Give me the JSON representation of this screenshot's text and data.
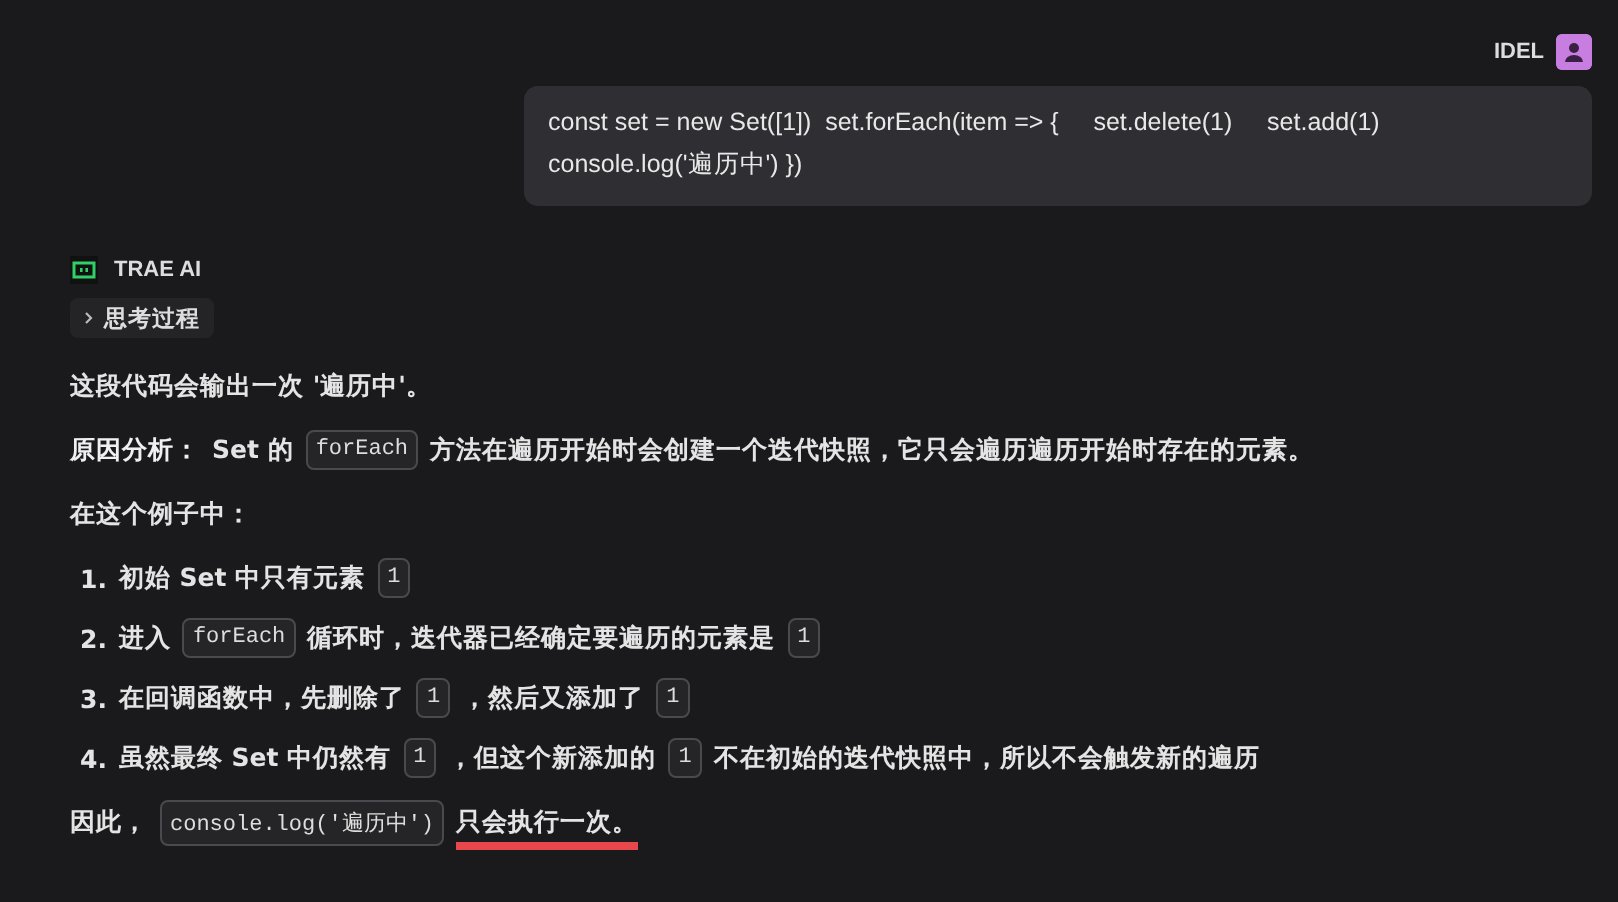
{
  "user": {
    "name": "IDEL",
    "message": "const set = new Set([1])  set.forEach(item => {     set.delete(1)     set.add(1)     console.log('遍历中') })"
  },
  "assistant": {
    "name": "TRAE AI",
    "thinking": {
      "label": "思考过程",
      "expanded": false
    },
    "blocks": [
      {
        "kind": "paragraph",
        "parts": [
          {
            "kind": "text",
            "text": "这段代码会输出一次 '遍历中'。"
          }
        ]
      },
      {
        "kind": "paragraph",
        "parts": [
          {
            "kind": "strong",
            "text": "原因分析："
          },
          {
            "kind": "text",
            "text": "Set 的"
          },
          {
            "kind": "code",
            "text": "forEach"
          },
          {
            "kind": "text",
            "text": "方法在遍历开始时会创建一个迭代快照，它只会遍历遍历开始时存在的元素。"
          }
        ]
      },
      {
        "kind": "paragraph",
        "parts": [
          {
            "kind": "text",
            "text": "在这个例子中："
          }
        ]
      },
      {
        "kind": "list",
        "items": [
          {
            "number": "1.",
            "parts": [
              {
                "kind": "text",
                "text": "初始 Set 中只有元素"
              },
              {
                "kind": "code",
                "text": "1"
              }
            ]
          },
          {
            "number": "2.",
            "parts": [
              {
                "kind": "text",
                "text": "进入"
              },
              {
                "kind": "code",
                "text": "forEach"
              },
              {
                "kind": "text",
                "text": "循环时，迭代器已经确定要遍历的元素是"
              },
              {
                "kind": "code",
                "text": "1"
              }
            ]
          },
          {
            "number": "3.",
            "parts": [
              {
                "kind": "text",
                "text": "在回调函数中，先删除了"
              },
              {
                "kind": "code",
                "text": "1"
              },
              {
                "kind": "text",
                "text": "，然后又添加了"
              },
              {
                "kind": "code",
                "text": "1"
              }
            ]
          },
          {
            "number": "4.",
            "parts": [
              {
                "kind": "text",
                "text": "虽然最终 Set 中仍然有"
              },
              {
                "kind": "code",
                "text": "1"
              },
              {
                "kind": "text",
                "text": "，但这个新添加的"
              },
              {
                "kind": "code",
                "text": "1"
              },
              {
                "kind": "text",
                "text": "不在初始的迭代快照中，所以不会触发新的遍历"
              }
            ]
          }
        ]
      },
      {
        "kind": "paragraph",
        "parts": [
          {
            "kind": "text",
            "text": "因此，"
          },
          {
            "kind": "code",
            "text": "console.log('遍历中')"
          },
          {
            "kind": "text",
            "text": "只会执行一次。",
            "underlined": true
          }
        ]
      }
    ]
  }
}
